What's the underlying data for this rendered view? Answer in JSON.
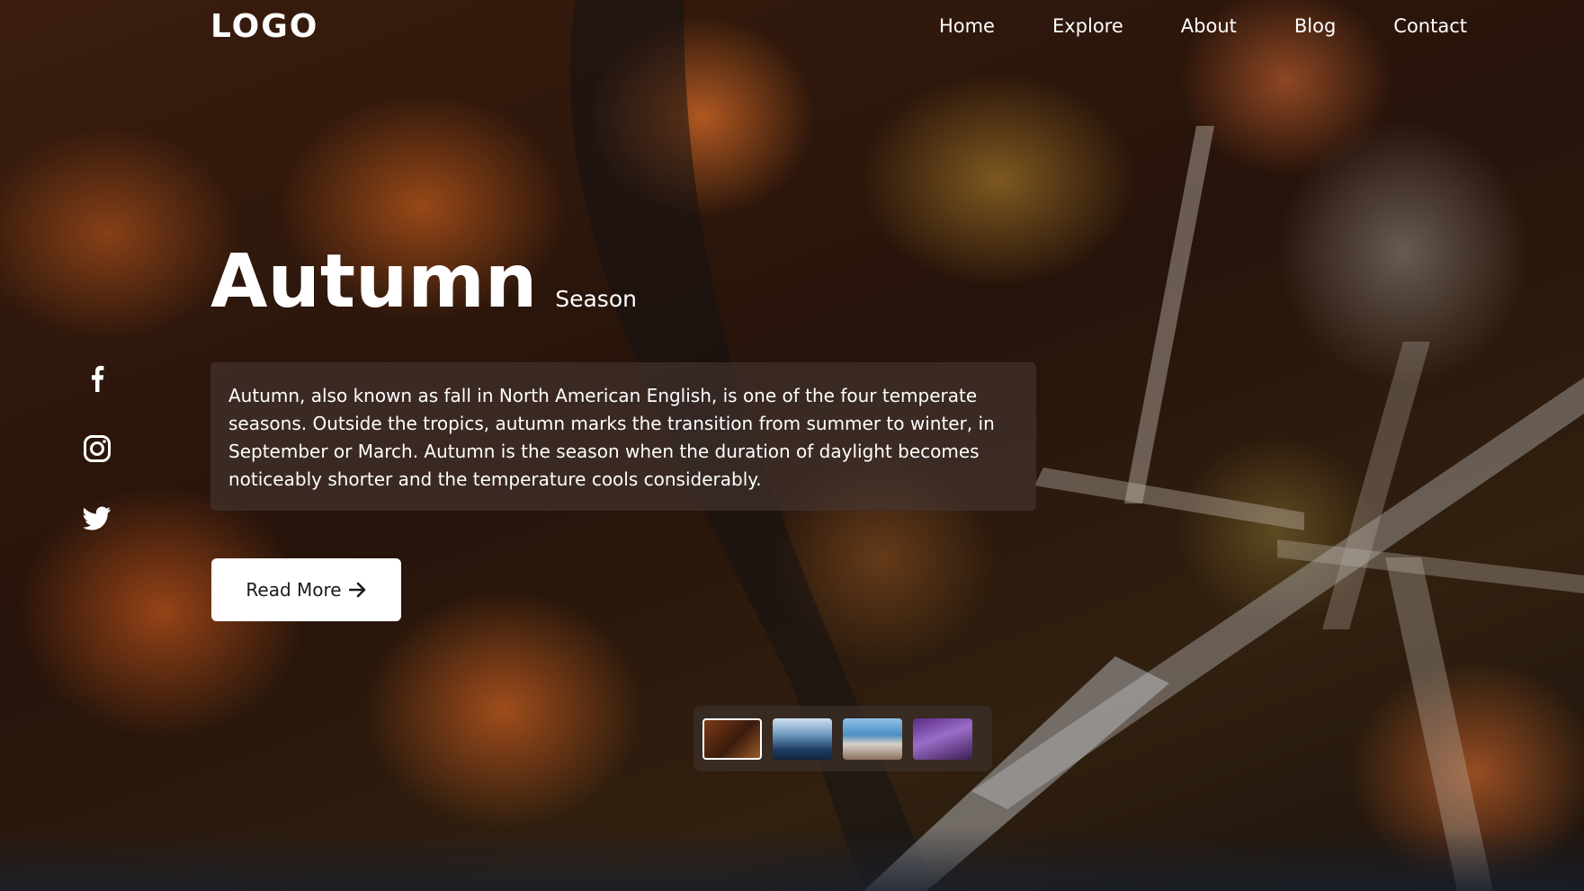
{
  "header": {
    "logo": "LOGO",
    "nav": [
      "Home",
      "Explore",
      "About",
      "Blog",
      "Contact"
    ]
  },
  "hero": {
    "title": "Autumn",
    "subtitle": "Season",
    "description": "Autumn, also known as fall in North American English, is one of the four temperate seasons. Outside the tropics, autumn marks the transition from summer to winter, in September or March. Autumn is the season when the duration of daylight becomes noticeably shorter and the temperature cools considerably.",
    "button_label": "Read More",
    "button_icon": "arrow-right-icon"
  },
  "social": [
    "facebook-icon",
    "instagram-icon",
    "twitter-icon"
  ],
  "thumbnails": {
    "items": [
      "autumn",
      "winter",
      "coast",
      "lavender"
    ],
    "active": "autumn"
  },
  "colors": {
    "text": "#ffffff",
    "button_bg": "#ffffff",
    "button_text": "#1a1a1a"
  }
}
